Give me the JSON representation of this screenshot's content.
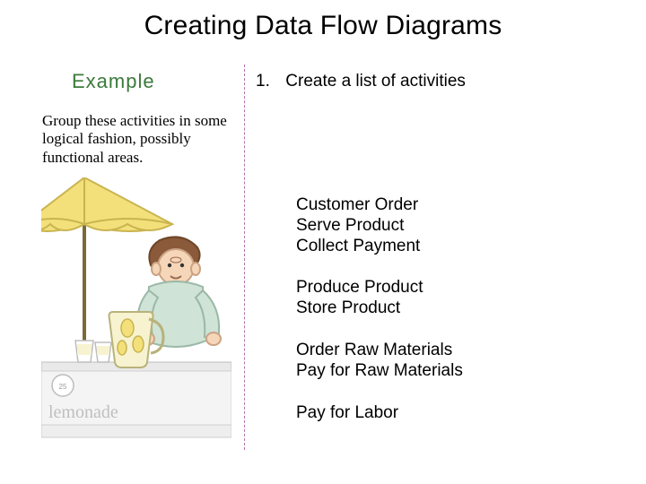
{
  "title": "Creating Data Flow Diagrams",
  "example_label": "Example",
  "instruction": "Group these activities in some logical fashion, possibly functional areas.",
  "step": {
    "num": "1.",
    "text": "Create a list of activities"
  },
  "groups": [
    [
      "Customer Order",
      "Serve Product",
      "Collect Payment"
    ],
    [
      "Produce Product",
      "Store Product"
    ],
    [
      "Order Raw Materials",
      "Pay for Raw Materials"
    ],
    [
      "Pay for Labor"
    ]
  ],
  "illustration_label": "lemonade"
}
